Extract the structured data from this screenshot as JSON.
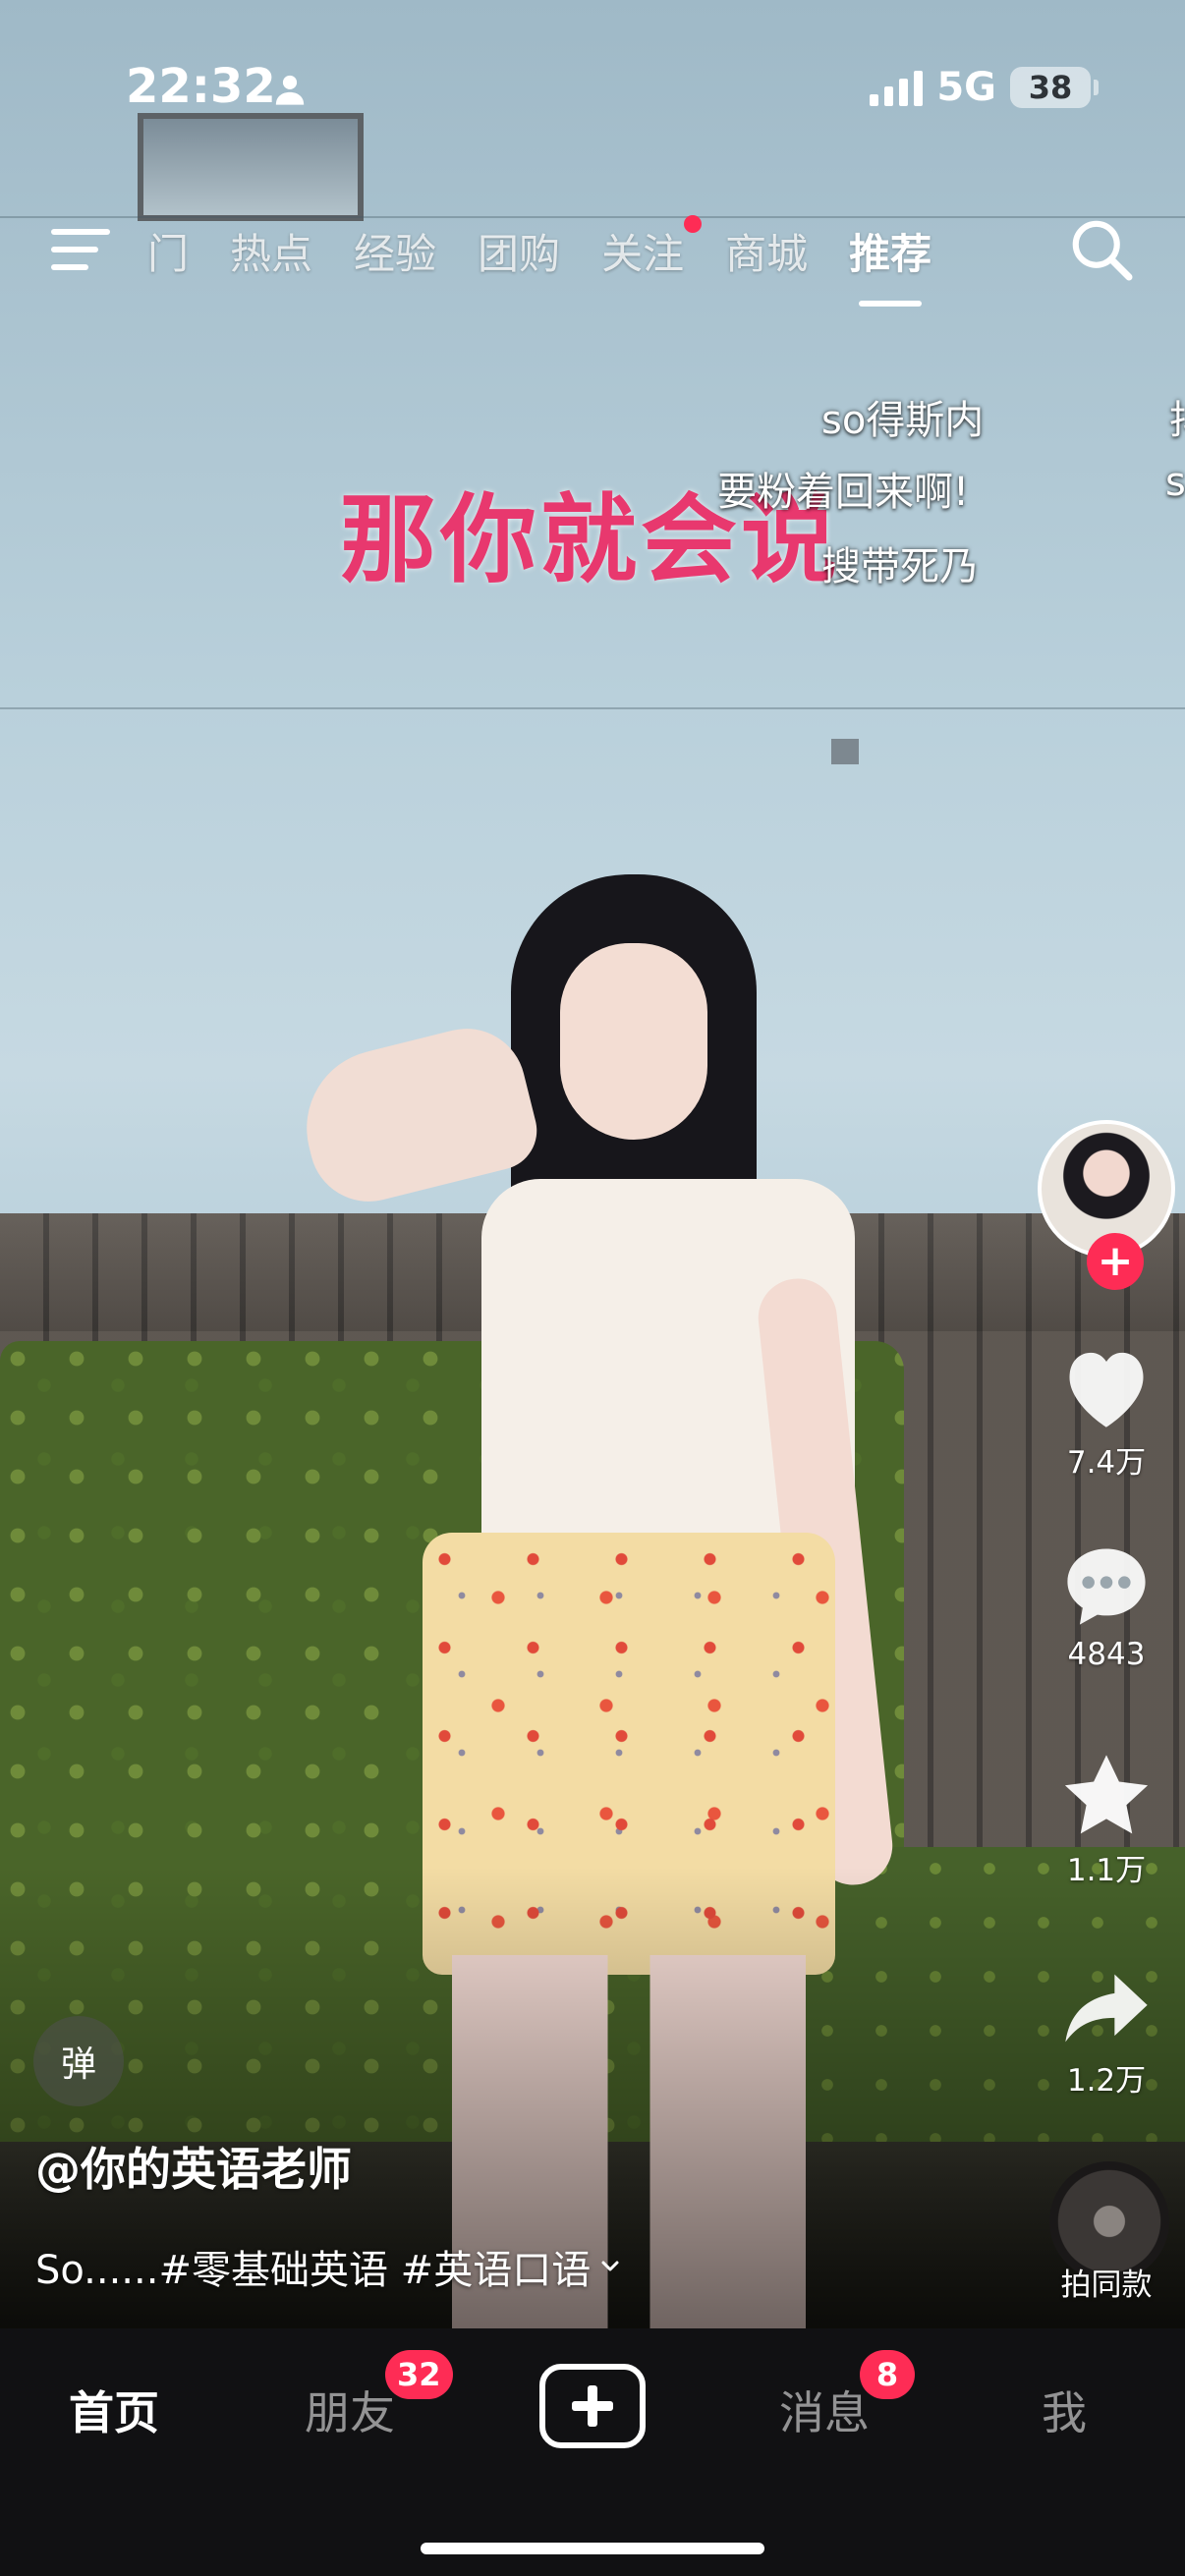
{
  "status_bar": {
    "time": "22:32",
    "network": "5G",
    "battery": "38"
  },
  "top_nav": {
    "tabs": [
      {
        "label": "门",
        "active": false,
        "dot": false
      },
      {
        "label": "热点",
        "active": false,
        "dot": false
      },
      {
        "label": "经验",
        "active": false,
        "dot": false
      },
      {
        "label": "团购",
        "active": false,
        "dot": false
      },
      {
        "label": "关注",
        "active": false,
        "dot": true
      },
      {
        "label": "商城",
        "active": false,
        "dot": false
      },
      {
        "label": "推荐",
        "active": true,
        "dot": false
      }
    ],
    "icons": [
      "menu-icon",
      "search-icon"
    ]
  },
  "video": {
    "caption_overlay": "那你就会说",
    "danmaku": [
      {
        "text": "so得斯内"
      },
      {
        "text": "要粉着回来啊!"
      },
      {
        "text": "搜带死乃"
      },
      {
        "text": "抖"
      },
      {
        "text": "s"
      }
    ]
  },
  "rail": {
    "follow_symbol": "+",
    "like_count": "7.4万",
    "comment_count": "4843",
    "favorite_count": "1.1万",
    "share_count": "1.2万",
    "same_style_label": "拍同款"
  },
  "danmu_toggle_label": "弹",
  "caption": {
    "author": "@你的英语老师",
    "description": "So......#零基础英语 #英语口语"
  },
  "bottom_nav": {
    "items": [
      {
        "label": "首页",
        "active": true
      },
      {
        "label": "朋友",
        "badge": "32"
      },
      {
        "label": "消息",
        "badge": "8"
      },
      {
        "label": "我"
      }
    ]
  },
  "colors": {
    "accent": "#fe2c55",
    "caption_pink": "#e8386e",
    "nav_bg": "#111113"
  }
}
